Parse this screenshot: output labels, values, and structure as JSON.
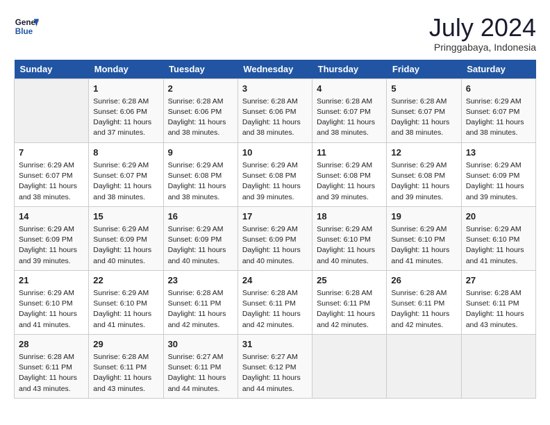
{
  "header": {
    "logo_line1": "General",
    "logo_line2": "Blue",
    "month": "July 2024",
    "location": "Pringgabaya, Indonesia"
  },
  "days_of_week": [
    "Sunday",
    "Monday",
    "Tuesday",
    "Wednesday",
    "Thursday",
    "Friday",
    "Saturday"
  ],
  "weeks": [
    [
      {
        "day": "",
        "info": ""
      },
      {
        "day": "1",
        "info": "Sunrise: 6:28 AM\nSunset: 6:06 PM\nDaylight: 11 hours\nand 37 minutes."
      },
      {
        "day": "2",
        "info": "Sunrise: 6:28 AM\nSunset: 6:06 PM\nDaylight: 11 hours\nand 38 minutes."
      },
      {
        "day": "3",
        "info": "Sunrise: 6:28 AM\nSunset: 6:06 PM\nDaylight: 11 hours\nand 38 minutes."
      },
      {
        "day": "4",
        "info": "Sunrise: 6:28 AM\nSunset: 6:07 PM\nDaylight: 11 hours\nand 38 minutes."
      },
      {
        "day": "5",
        "info": "Sunrise: 6:28 AM\nSunset: 6:07 PM\nDaylight: 11 hours\nand 38 minutes."
      },
      {
        "day": "6",
        "info": "Sunrise: 6:29 AM\nSunset: 6:07 PM\nDaylight: 11 hours\nand 38 minutes."
      }
    ],
    [
      {
        "day": "7",
        "info": "Sunrise: 6:29 AM\nSunset: 6:07 PM\nDaylight: 11 hours\nand 38 minutes."
      },
      {
        "day": "8",
        "info": "Sunrise: 6:29 AM\nSunset: 6:07 PM\nDaylight: 11 hours\nand 38 minutes."
      },
      {
        "day": "9",
        "info": "Sunrise: 6:29 AM\nSunset: 6:08 PM\nDaylight: 11 hours\nand 38 minutes."
      },
      {
        "day": "10",
        "info": "Sunrise: 6:29 AM\nSunset: 6:08 PM\nDaylight: 11 hours\nand 39 minutes."
      },
      {
        "day": "11",
        "info": "Sunrise: 6:29 AM\nSunset: 6:08 PM\nDaylight: 11 hours\nand 39 minutes."
      },
      {
        "day": "12",
        "info": "Sunrise: 6:29 AM\nSunset: 6:08 PM\nDaylight: 11 hours\nand 39 minutes."
      },
      {
        "day": "13",
        "info": "Sunrise: 6:29 AM\nSunset: 6:09 PM\nDaylight: 11 hours\nand 39 minutes."
      }
    ],
    [
      {
        "day": "14",
        "info": "Sunrise: 6:29 AM\nSunset: 6:09 PM\nDaylight: 11 hours\nand 39 minutes."
      },
      {
        "day": "15",
        "info": "Sunrise: 6:29 AM\nSunset: 6:09 PM\nDaylight: 11 hours\nand 40 minutes."
      },
      {
        "day": "16",
        "info": "Sunrise: 6:29 AM\nSunset: 6:09 PM\nDaylight: 11 hours\nand 40 minutes."
      },
      {
        "day": "17",
        "info": "Sunrise: 6:29 AM\nSunset: 6:09 PM\nDaylight: 11 hours\nand 40 minutes."
      },
      {
        "day": "18",
        "info": "Sunrise: 6:29 AM\nSunset: 6:10 PM\nDaylight: 11 hours\nand 40 minutes."
      },
      {
        "day": "19",
        "info": "Sunrise: 6:29 AM\nSunset: 6:10 PM\nDaylight: 11 hours\nand 41 minutes."
      },
      {
        "day": "20",
        "info": "Sunrise: 6:29 AM\nSunset: 6:10 PM\nDaylight: 11 hours\nand 41 minutes."
      }
    ],
    [
      {
        "day": "21",
        "info": "Sunrise: 6:29 AM\nSunset: 6:10 PM\nDaylight: 11 hours\nand 41 minutes."
      },
      {
        "day": "22",
        "info": "Sunrise: 6:29 AM\nSunset: 6:10 PM\nDaylight: 11 hours\nand 41 minutes."
      },
      {
        "day": "23",
        "info": "Sunrise: 6:28 AM\nSunset: 6:11 PM\nDaylight: 11 hours\nand 42 minutes."
      },
      {
        "day": "24",
        "info": "Sunrise: 6:28 AM\nSunset: 6:11 PM\nDaylight: 11 hours\nand 42 minutes."
      },
      {
        "day": "25",
        "info": "Sunrise: 6:28 AM\nSunset: 6:11 PM\nDaylight: 11 hours\nand 42 minutes."
      },
      {
        "day": "26",
        "info": "Sunrise: 6:28 AM\nSunset: 6:11 PM\nDaylight: 11 hours\nand 42 minutes."
      },
      {
        "day": "27",
        "info": "Sunrise: 6:28 AM\nSunset: 6:11 PM\nDaylight: 11 hours\nand 43 minutes."
      }
    ],
    [
      {
        "day": "28",
        "info": "Sunrise: 6:28 AM\nSunset: 6:11 PM\nDaylight: 11 hours\nand 43 minutes."
      },
      {
        "day": "29",
        "info": "Sunrise: 6:28 AM\nSunset: 6:11 PM\nDaylight: 11 hours\nand 43 minutes."
      },
      {
        "day": "30",
        "info": "Sunrise: 6:27 AM\nSunset: 6:11 PM\nDaylight: 11 hours\nand 44 minutes."
      },
      {
        "day": "31",
        "info": "Sunrise: 6:27 AM\nSunset: 6:12 PM\nDaylight: 11 hours\nand 44 minutes."
      },
      {
        "day": "",
        "info": ""
      },
      {
        "day": "",
        "info": ""
      },
      {
        "day": "",
        "info": ""
      }
    ]
  ]
}
